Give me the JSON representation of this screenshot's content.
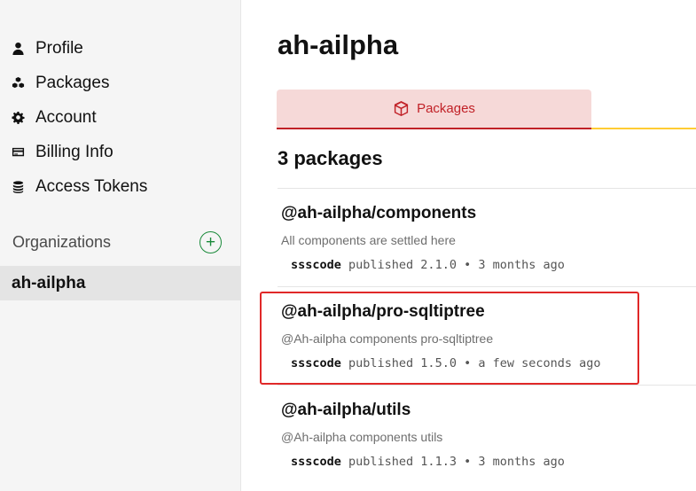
{
  "sidebar": {
    "items": [
      {
        "label": "Profile",
        "icon": "user-icon"
      },
      {
        "label": "Packages",
        "icon": "cubes-icon"
      },
      {
        "label": "Account",
        "icon": "gear-icon"
      },
      {
        "label": "Billing Info",
        "icon": "credit-card-icon"
      },
      {
        "label": "Access Tokens",
        "icon": "coins-icon"
      }
    ],
    "organizations_title": "Organizations",
    "add_symbol": "+",
    "selected_org": "ah-ailpha"
  },
  "main": {
    "org_name": "ah-ailpha",
    "tabs": [
      {
        "label": "Packages",
        "icon": "package-icon"
      }
    ],
    "package_count": "3 packages",
    "packages": [
      {
        "name": "@ah-ailpha/components",
        "description": "All components are settled here",
        "author": "ssscode",
        "published_text": "published 2.1.0 • 3 months ago"
      },
      {
        "name": "@ah-ailpha/pro-sqltiptree",
        "description": "@Ah-ailpha components pro-sqltiptree",
        "author": "ssscode",
        "published_text": "published 1.5.0 • a few seconds ago"
      },
      {
        "name": "@ah-ailpha/utils",
        "description": "@Ah-ailpha components utils",
        "author": "ssscode",
        "published_text": "published 1.1.3 • 3 months ago"
      }
    ]
  },
  "colors": {
    "accent_red": "#c12127",
    "tab_bg": "#f6d9d8",
    "tab_underline": "#ffcc33",
    "add_green": "#1a8a3a",
    "highlight_border": "#e02828"
  }
}
